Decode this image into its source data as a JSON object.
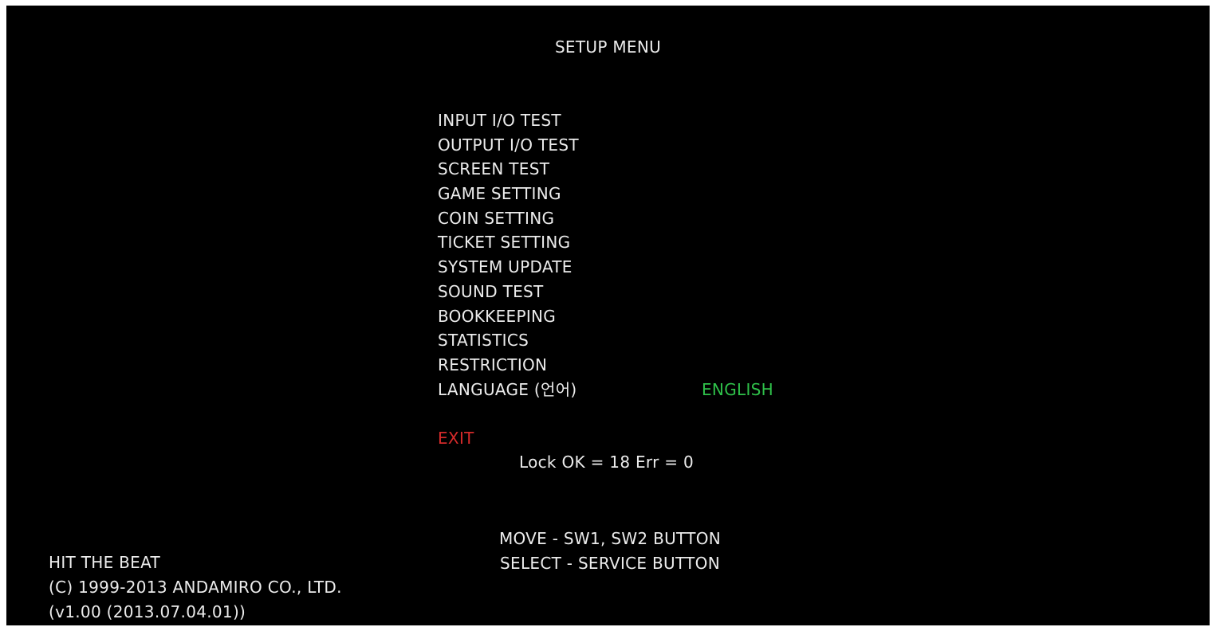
{
  "title": "SETUP MENU",
  "menu": {
    "items": [
      {
        "label": "INPUT I/O TEST"
      },
      {
        "label": "OUTPUT I/O TEST"
      },
      {
        "label": "SCREEN TEST"
      },
      {
        "label": "GAME SETTING"
      },
      {
        "label": "COIN SETTING"
      },
      {
        "label": "TICKET SETTING"
      },
      {
        "label": "SYSTEM UPDATE"
      },
      {
        "label": "SOUND TEST"
      },
      {
        "label": "BOOKKEEPING"
      },
      {
        "label": "STATISTICS"
      },
      {
        "label": "RESTRICTION"
      },
      {
        "label": "LANGUAGE (언어)",
        "value": "ENGLISH"
      }
    ],
    "exit_label": "EXIT"
  },
  "status": {
    "lock": "Lock OK = 18 Err = 0"
  },
  "help": {
    "move": "MOVE - SW1, SW2 BUTTON",
    "select": "SELECT - SERVICE BUTTON"
  },
  "footer": {
    "game_name": "HIT THE BEAT",
    "copyright": "(C) 1999-2013 ANDAMIRO CO., LTD.",
    "version": "(v1.00 (2013.07.04.01))"
  },
  "colors": {
    "background": "#000000",
    "text": "#ececec",
    "value": "#2fc14a",
    "exit": "#d42a2a"
  }
}
